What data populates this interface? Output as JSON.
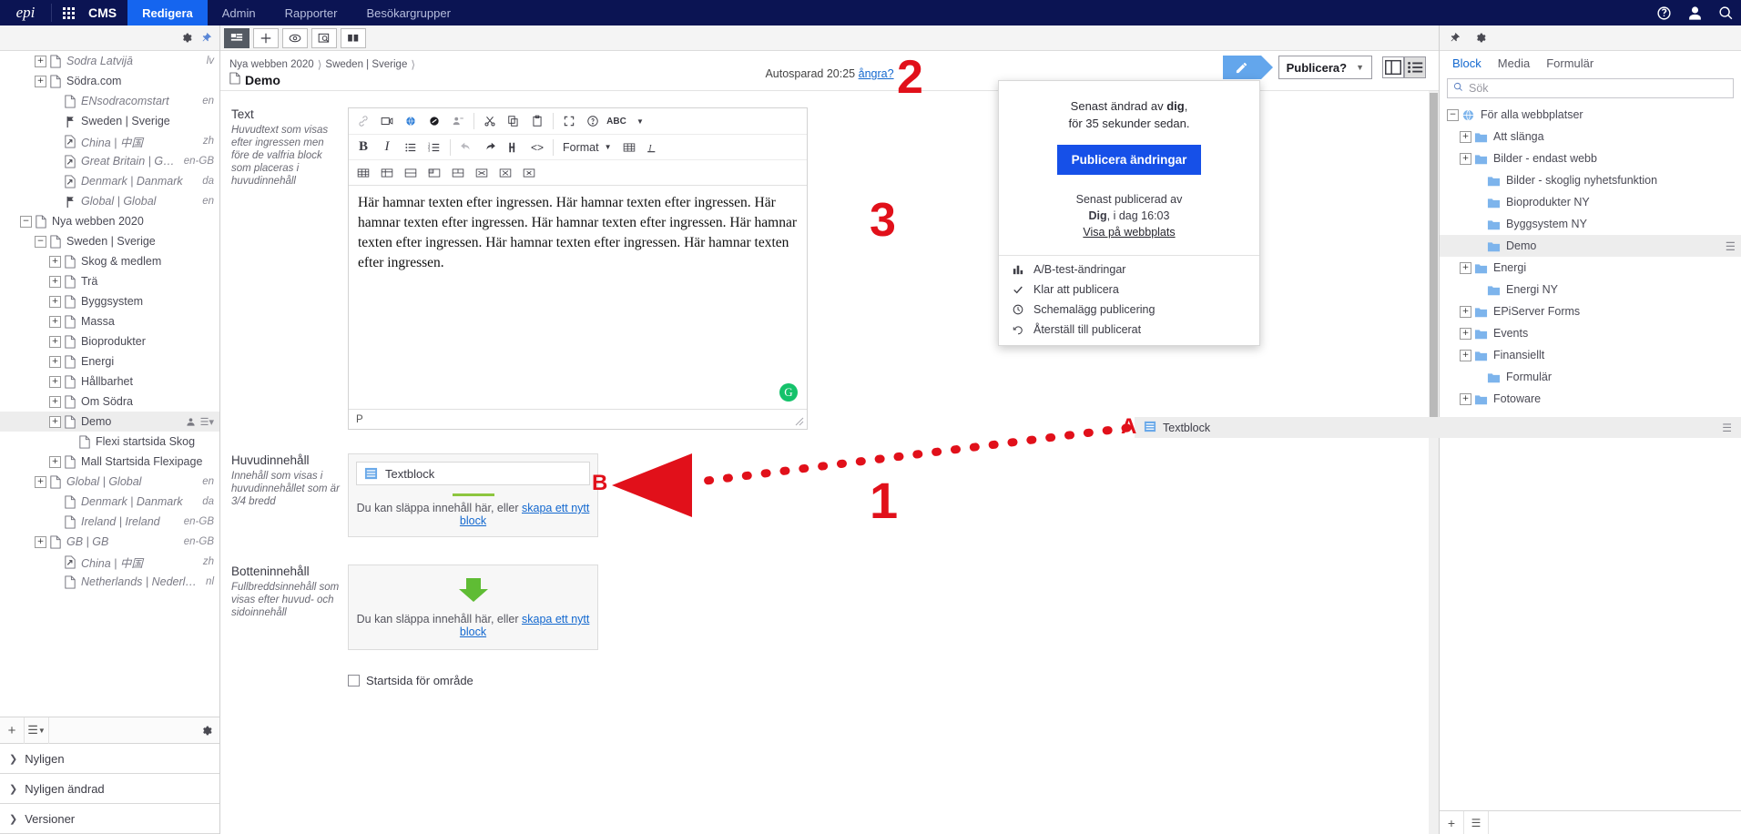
{
  "colors": {
    "brand_navy": "#0b1453",
    "accent_blue": "#1565ef",
    "publish_blue": "#1650e8",
    "annotation_red": "#e1101a",
    "green": "#8dc63f"
  },
  "globalbar": {
    "logo": "epi",
    "waffle_icon": "apps-grid-icon",
    "product": "CMS",
    "items": [
      {
        "label": "Redigera",
        "active": true
      },
      {
        "label": "Admin",
        "active": false
      },
      {
        "label": "Rapporter",
        "active": false
      },
      {
        "label": "Besökargrupper",
        "active": false
      }
    ],
    "right_icons": [
      "help-icon",
      "user-icon",
      "search-icon"
    ]
  },
  "leftpane": {
    "toolbar_icons": [
      "gear-icon",
      "pin-icon"
    ],
    "tree": [
      {
        "label": "Sodra Latvijā",
        "lang": "lv",
        "indent": 2,
        "toggle": "plus",
        "icon": "page",
        "italic": true
      },
      {
        "label": "Södra.com",
        "lang": "",
        "indent": 2,
        "toggle": "plus",
        "icon": "page",
        "italic": false
      },
      {
        "label": "ENsodracomstart",
        "lang": "en",
        "indent": 3,
        "toggle": "none",
        "icon": "page",
        "italic": true
      },
      {
        "label": "Sweden | Sverige",
        "lang": "",
        "indent": 3,
        "toggle": "none",
        "icon": "shortcut-flag",
        "italic": false
      },
      {
        "label": "China | 中国",
        "lang": "zh",
        "indent": 3,
        "toggle": "none",
        "icon": "external",
        "italic": true
      },
      {
        "label": "Great Britain | Great Bri...",
        "lang": "en-GB",
        "indent": 3,
        "toggle": "none",
        "icon": "external",
        "italic": true
      },
      {
        "label": "Denmark | Danmark",
        "lang": "da",
        "indent": 3,
        "toggle": "none",
        "icon": "external",
        "italic": true
      },
      {
        "label": "Global | Global",
        "lang": "en",
        "indent": 3,
        "toggle": "none",
        "icon": "shortcut-flag",
        "italic": true
      },
      {
        "label": "Nya webben 2020",
        "lang": "",
        "indent": 1,
        "toggle": "minus",
        "icon": "page",
        "italic": false
      },
      {
        "label": "Sweden | Sverige",
        "lang": "",
        "indent": 2,
        "toggle": "minus",
        "icon": "page",
        "italic": false
      },
      {
        "label": "Skog & medlem",
        "lang": "",
        "indent": 3,
        "toggle": "plus",
        "icon": "page",
        "italic": false
      },
      {
        "label": "Trä",
        "lang": "",
        "indent": 3,
        "toggle": "plus",
        "icon": "page",
        "italic": false
      },
      {
        "label": "Byggsystem",
        "lang": "",
        "indent": 3,
        "toggle": "plus",
        "icon": "page",
        "italic": false
      },
      {
        "label": "Massa",
        "lang": "",
        "indent": 3,
        "toggle": "plus",
        "icon": "page",
        "italic": false
      },
      {
        "label": "Bioprodukter",
        "lang": "",
        "indent": 3,
        "toggle": "plus",
        "icon": "page",
        "italic": false
      },
      {
        "label": "Energi",
        "lang": "",
        "indent": 3,
        "toggle": "plus",
        "icon": "page",
        "italic": false
      },
      {
        "label": "Hållbarhet",
        "lang": "",
        "indent": 3,
        "toggle": "plus",
        "icon": "page",
        "italic": false
      },
      {
        "label": "Om Södra",
        "lang": "",
        "indent": 3,
        "toggle": "plus",
        "icon": "page",
        "italic": false
      },
      {
        "label": "Demo",
        "lang": "",
        "indent": 3,
        "toggle": "plus",
        "icon": "page",
        "italic": false,
        "selected": true,
        "tools": true
      },
      {
        "label": "Flexi startsida Skog",
        "lang": "",
        "indent": 4,
        "toggle": "none",
        "icon": "page",
        "italic": false
      },
      {
        "label": "Mall Startsida Flexipage",
        "lang": "",
        "indent": 3,
        "toggle": "plus",
        "icon": "page",
        "italic": false
      },
      {
        "label": "Global | Global",
        "lang": "en",
        "indent": 2,
        "toggle": "plus",
        "icon": "page",
        "italic": true
      },
      {
        "label": "Denmark | Danmark",
        "lang": "da",
        "indent": 3,
        "toggle": "none",
        "icon": "page",
        "italic": true
      },
      {
        "label": "Ireland | Ireland",
        "lang": "en-GB",
        "indent": 3,
        "toggle": "none",
        "icon": "page",
        "italic": true
      },
      {
        "label": "GB | GB",
        "lang": "en-GB",
        "indent": 2,
        "toggle": "plus",
        "icon": "page",
        "italic": true
      },
      {
        "label": "China | 中国",
        "lang": "zh",
        "indent": 3,
        "toggle": "none",
        "icon": "external",
        "italic": true
      },
      {
        "label": "Netherlands | Nederland",
        "lang": "nl",
        "indent": 3,
        "toggle": "none",
        "icon": "page",
        "italic": true
      }
    ],
    "buttonbar": {
      "add_label": "+",
      "menu_label": "≡",
      "gear": "gear-icon"
    },
    "accordions": [
      {
        "label": "Nyligen"
      },
      {
        "label": "Nyligen ändrad"
      },
      {
        "label": "Versioner"
      }
    ]
  },
  "centerpane": {
    "toolbar_buttons": [
      "navigation-pane-icon",
      "plus-icon",
      "preview-eye-icon",
      "inspect-icon",
      "compare-icon"
    ],
    "breadcrumbs": [
      "Nya webben 2020",
      "Sweden | Sverige"
    ],
    "page_title": "Demo",
    "autosave_text": "Autosparad 20:25",
    "autosave_link": "ångra?",
    "publish_button": "Publicera?",
    "edit_mode_icon": "pencil-icon",
    "view_toggle": [
      "layout-view-icon",
      "list-view-icon"
    ],
    "properties": [
      {
        "name": "Text",
        "description": "Huvudtext som visas efter ingressen men före de valfria block som placeras i huvudinnehåll",
        "type": "richtext",
        "status": "P",
        "body": "Här hamnar texten efter ingressen. Här hamnar texten efter ingressen. Här hamnar texten efter ingressen. Här hamnar texten efter ingressen. Här hamnar texten efter ingressen. Här hamnar texten efter ingressen. Här hamnar texten efter ingressen."
      },
      {
        "name": "Huvudinnehåll",
        "description": "Innehåll som visas i huvudinnehållet som är 3/4 bredd",
        "type": "dropzone",
        "block_label": "Textblock",
        "drop_text": "Du kan släppa innehåll här, eller ",
        "drop_link": "skapa ett nytt block"
      },
      {
        "name": "Botteninnehåll",
        "description": "Fullbreddsinnehåll som visas efter huvud- och sidoinnehåll",
        "type": "dropzone-empty",
        "drop_text": "Du kan släppa innehåll här, eller ",
        "drop_link": "skapa ett nytt block"
      }
    ],
    "checkbox_label": "Startsida för område",
    "rte_toolbar": {
      "row1": [
        "link-icon",
        "video-icon",
        "globe-icon",
        "anchor-icon",
        "unlink-user-icon",
        "cut-icon",
        "copy-icon",
        "paste-icon",
        "fullscreen-icon",
        "help-icon",
        "spellcheck-icon",
        "chevron-down-icon"
      ],
      "row2": [
        "bold-icon",
        "italic-icon",
        "bullet-list-icon",
        "numbered-list-icon",
        "undo-icon",
        "redo-icon",
        "find-replace-icon",
        "source-code-icon",
        "format-dropdown",
        "table-icon",
        "clear-format-icon"
      ],
      "row3": [
        "table-insert-icon",
        "table-props-icon",
        "row-props-icon",
        "cell-props-icon",
        "merge-cells-icon",
        "delete-row-icon",
        "delete-col-icon",
        "split-cell-icon"
      ],
      "format_label": "Format"
    }
  },
  "publish_panel": {
    "modified_prefix": "Senast ändrad av ",
    "modified_user": "dig",
    "modified_suffix": ",",
    "modified_time": "för 35 sekunder sedan.",
    "cta": "Publicera ändringar",
    "published_by_label": "Senast publicerad av",
    "published_user": "Dig",
    "published_time": ", i dag 16:03",
    "view_link": "Visa på webbplats",
    "menu": [
      {
        "label": "A/B-test-ändringar",
        "icon": "bar-chart-icon"
      },
      {
        "label": "Klar att publicera",
        "icon": "check-icon"
      },
      {
        "label": "Schemalägg publicering",
        "icon": "clock-icon"
      },
      {
        "label": "Återställ till publicerat",
        "icon": "undo-icon"
      }
    ]
  },
  "rightpane": {
    "toolbar_icons": [
      "pin-icon",
      "gear-icon"
    ],
    "tabs": [
      {
        "label": "Block",
        "active": true
      },
      {
        "label": "Media",
        "active": false
      },
      {
        "label": "Formulär",
        "active": false
      }
    ],
    "search_placeholder": "Sök",
    "search_icon": "search-icon",
    "tree": [
      {
        "label": "För alla webbplatser",
        "indent": 0,
        "toggle": "minus",
        "icon": "globe"
      },
      {
        "label": "Att slänga",
        "indent": 1,
        "toggle": "plus",
        "icon": "folder"
      },
      {
        "label": "Bilder - endast webb",
        "indent": 1,
        "toggle": "plus",
        "icon": "folder"
      },
      {
        "label": "Bilder - skoglig nyhetsfunktion",
        "indent": 2,
        "toggle": "none",
        "icon": "folder"
      },
      {
        "label": "Bioprodukter NY",
        "indent": 2,
        "toggle": "none",
        "icon": "folder"
      },
      {
        "label": "Byggsystem NY",
        "indent": 2,
        "toggle": "none",
        "icon": "folder"
      },
      {
        "label": "Demo",
        "indent": 2,
        "toggle": "none",
        "icon": "folder",
        "selected": true,
        "menu": true
      },
      {
        "label": "Energi",
        "indent": 1,
        "toggle": "plus",
        "icon": "folder"
      },
      {
        "label": "Energi NY",
        "indent": 2,
        "toggle": "none",
        "icon": "folder"
      },
      {
        "label": "EPiServer Forms",
        "indent": 1,
        "toggle": "plus",
        "icon": "folder"
      },
      {
        "label": "Events",
        "indent": 1,
        "toggle": "plus",
        "icon": "folder"
      },
      {
        "label": "Finansiellt",
        "indent": 1,
        "toggle": "plus",
        "icon": "folder"
      },
      {
        "label": "Formulär",
        "indent": 2,
        "toggle": "none",
        "icon": "folder"
      },
      {
        "label": "Fotoware",
        "indent": 1,
        "toggle": "plus",
        "icon": "folder"
      }
    ],
    "dragged_item": {
      "label": "Textblock",
      "icon": "block-icon",
      "menu": true
    }
  },
  "annotations": [
    {
      "label": "1",
      "kind": "number"
    },
    {
      "label": "2",
      "kind": "number"
    },
    {
      "label": "3",
      "kind": "number"
    },
    {
      "label": "A",
      "kind": "letter"
    },
    {
      "label": "B",
      "kind": "letter"
    }
  ]
}
